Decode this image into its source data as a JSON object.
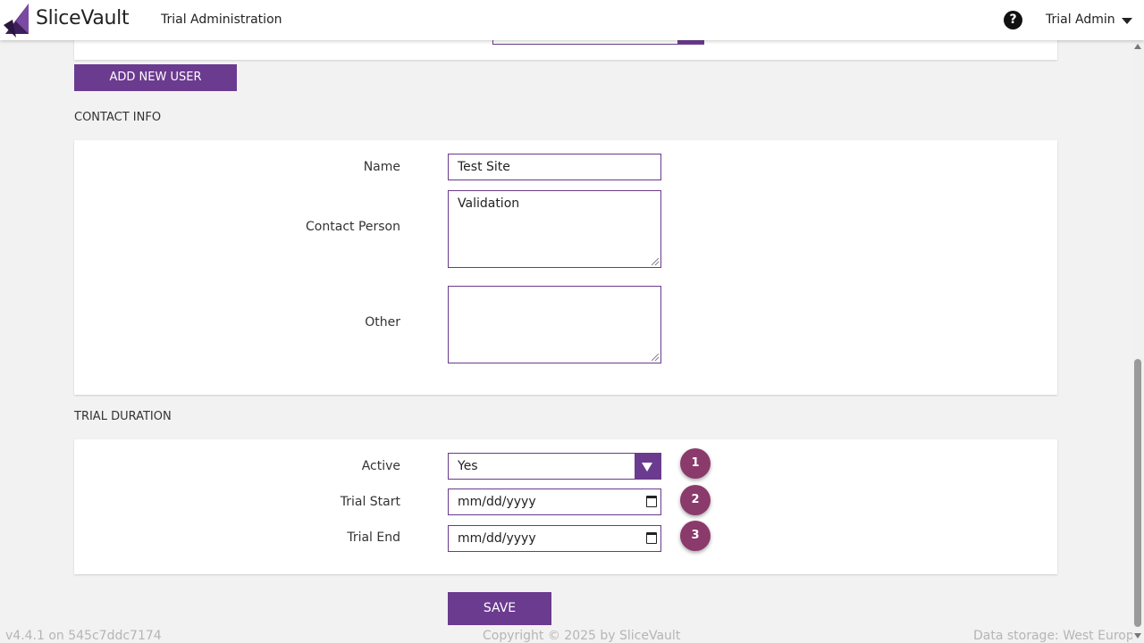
{
  "header": {
    "brand": "SliceVault",
    "title": "Trial Administration",
    "help_icon": "question-circle-icon",
    "user": "Trial Admin"
  },
  "actions": {
    "add_user_label": "ADD NEW USER",
    "save_label": "SAVE"
  },
  "contact": {
    "section_title": "CONTACT INFO",
    "name_label": "Name",
    "name_value": "Test Site",
    "contact_person_label": "Contact Person",
    "contact_person_value": "Validation",
    "other_label": "Other",
    "other_value": ""
  },
  "trial": {
    "section_title": "TRIAL DURATION",
    "active_label": "Active",
    "active_value": "Yes",
    "start_label": "Trial Start",
    "start_placeholder": "mm/dd/yyyy",
    "end_label": "Trial End",
    "end_placeholder": "mm/dd/yyyy",
    "badges": [
      "1",
      "2",
      "3"
    ]
  },
  "footer": {
    "version": "v4.4.1 on 545c7ddc7174",
    "copyright": "Copyright © 2025 by SliceVault",
    "storage": "Data storage: West Europe"
  },
  "colors": {
    "accent": "#6b3b8f",
    "badge": "#8b3a6c"
  }
}
